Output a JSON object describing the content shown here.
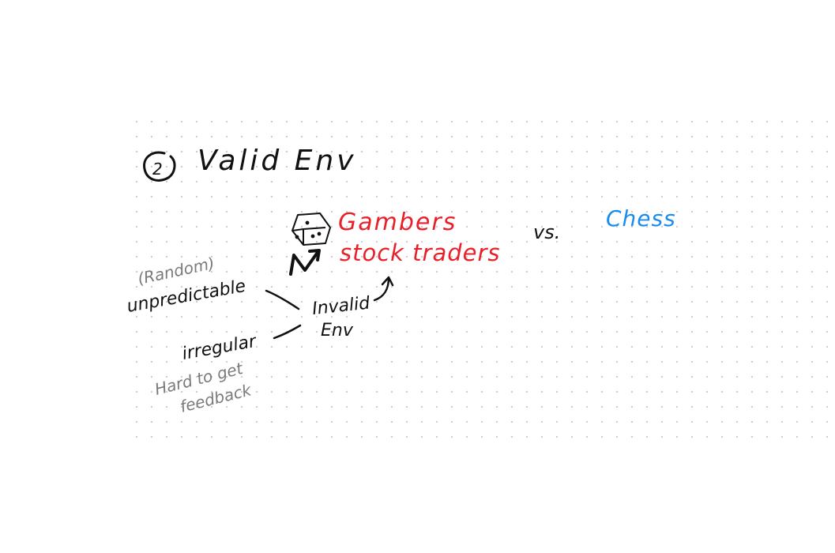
{
  "heading": {
    "number": "2",
    "title": "Valid Env"
  },
  "examples": {
    "line1": "Gambers",
    "line2": "stock traders"
  },
  "versus": "vs.",
  "counter_example": "Chess",
  "center_node": {
    "line1": "Invalid",
    "line2": "Env"
  },
  "left_upper": {
    "paren_note": "(Random)",
    "label": "unpredictable"
  },
  "left_lower": {
    "label": "irregular",
    "note_line1": "Hard to get",
    "note_line2": "feedback"
  },
  "colors": {
    "ink": "#111111",
    "red": "#e8202a",
    "blue": "#1a8cf0",
    "gray": "#7a7a7a",
    "dot": "#c8c8c8"
  }
}
